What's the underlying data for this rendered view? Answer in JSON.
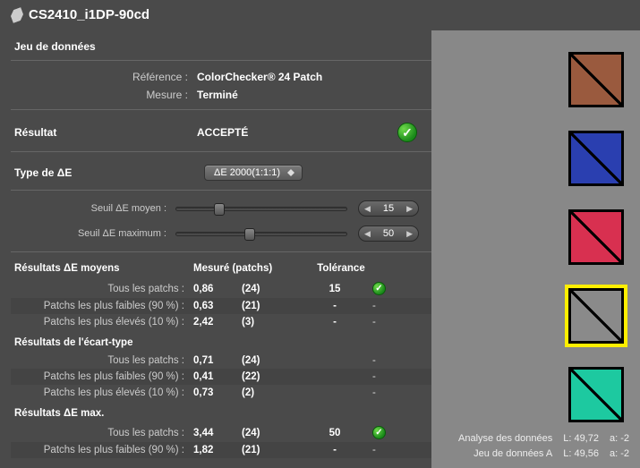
{
  "title": "CS2410_i1DP-90cd",
  "dataset": {
    "heading": "Jeu de données",
    "reference_label": "Référence :",
    "reference_value": "ColorChecker® 24 Patch",
    "measure_label": "Mesure :",
    "measure_value": "Terminé"
  },
  "result": {
    "label": "Résultat",
    "value": "ACCEPTÉ"
  },
  "deltae": {
    "type_label": "Type de ΔE",
    "type_value": "ΔE 2000(1:1:1)",
    "avg_threshold_label": "Seuil ΔE moyen :",
    "avg_threshold_value": "15",
    "max_threshold_label": "Seuil ΔE maximum :",
    "max_threshold_value": "50",
    "avg_thumb_pos": "22%",
    "max_thumb_pos": "40%"
  },
  "table": {
    "h_metric": "Résultats ΔE moyens",
    "h_measured": "Mesuré (patchs)",
    "h_tolerance": "Tolérance",
    "avg_rows": [
      {
        "label": "Tous les patchs :",
        "measured": "0,86",
        "patches": "(24)",
        "tol": "15",
        "ok": true
      },
      {
        "label": "Patchs les plus faibles (90 %) :",
        "measured": "0,63",
        "patches": "(21)",
        "tol": "-",
        "ok": false
      },
      {
        "label": "Patchs les plus élevés (10 %) :",
        "measured": "2,42",
        "patches": "(3)",
        "tol": "-",
        "ok": false
      }
    ],
    "std_heading": "Résultats de l'écart-type",
    "std_rows": [
      {
        "label": "Tous les patchs :",
        "measured": "0,71",
        "patches": "(24)",
        "tol": "",
        "ok": false
      },
      {
        "label": "Patchs les plus faibles (90 %) :",
        "measured": "0,41",
        "patches": "(22)",
        "tol": "",
        "ok": false
      },
      {
        "label": "Patchs les plus élevés (10 %) :",
        "measured": "0,73",
        "patches": "(2)",
        "tol": "",
        "ok": false
      }
    ],
    "max_heading": "Résultats ΔE max.",
    "max_rows": [
      {
        "label": "Tous les patchs :",
        "measured": "3,44",
        "patches": "(24)",
        "tol": "50",
        "ok": true
      },
      {
        "label": "Patchs les plus faibles (90 %) :",
        "measured": "1,82",
        "patches": "(21)",
        "tol": "-",
        "ok": false
      }
    ]
  },
  "swatches": [
    {
      "color": "#9a5a3e",
      "selected": false
    },
    {
      "color": "#2a3fb0",
      "selected": false
    },
    {
      "color": "#d83050",
      "selected": false
    },
    {
      "color": "#8a8a8a",
      "selected": true
    },
    {
      "color": "#1dc9a0",
      "selected": false
    }
  ],
  "bottom": {
    "analysis_label": "Analyse des données",
    "analysis_L": "L: 49,72",
    "analysis_a": "a: -2",
    "set_label": "Jeu de données A",
    "set_L": "L: 49,56",
    "set_a": "a: -2"
  }
}
